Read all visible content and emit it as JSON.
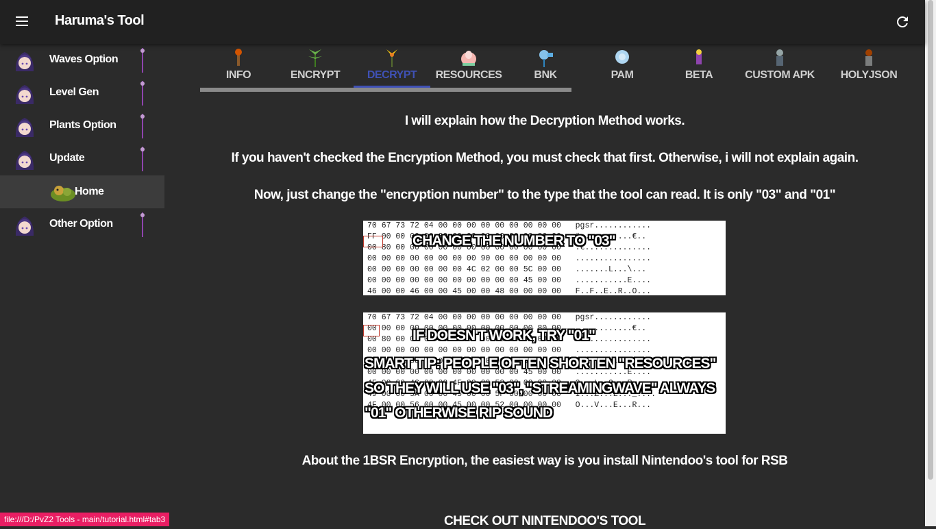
{
  "app": {
    "title": "Haruma's Tool"
  },
  "sidebar": {
    "items": [
      {
        "label": "Waves Option"
      },
      {
        "label": "Level Gen"
      },
      {
        "label": "Plants Option"
      },
      {
        "label": "Update"
      },
      {
        "label": "Home"
      },
      {
        "label": "Other Option"
      }
    ]
  },
  "tabs": [
    {
      "label": "INFO"
    },
    {
      "label": "ENCRYPT"
    },
    {
      "label": "DECRYPT"
    },
    {
      "label": "RESOURCES"
    },
    {
      "label": "BNK"
    },
    {
      "label": "PAM"
    },
    {
      "label": "BETA"
    },
    {
      "label": "CUSTOM APK"
    },
    {
      "label": "HOLYJSON"
    }
  ],
  "active_tab": "DECRYPT",
  "content": {
    "p1": "I will explain how the Decryption Method works.",
    "p2": "If you haven't checked the Encryption Method, you must check that first. Otherwise, i will not explain again.",
    "p3": "Now, just change the \"encryption number\" to the type that the tool can read. It is only \"03\" and \"01\"",
    "p4": "About the 1BSR Encryption, the easiest way is you install Nintendoo's tool for RSB",
    "p5": "CHECK OUT NINTENDOO'S TOOL"
  },
  "image1": {
    "hex": "70 67 73 72 04 00 00 00 00 00 00 00 00 00   pgsr............\nFF 00 00 00 00 00 00 00 00 00 00 00 80 00   ÿ...........€..\n00 80 00 00 00 00 00 00 00 00 00 00 00 00   .€..............\n00 00 00 00 00 00 00 00 90 00 00 00 00 00   ................\n00 00 00 00 00 00 00 4C 02 00 00 5C 00 00   .......L...\\...\n00 00 00 00 00 00 00 00 00 00 00 45 00 00   ...........E....\n46 00 00 46 00 00 45 00 00 48 00 00 00 00   F..F..E..R..O...",
    "overlay": "CHANGE THE NUMBER TO \"03\""
  },
  "image2": {
    "hex": "70 67 73 72 04 00 00 00 00 00 00 00 00 00   pgsr............\n00 00 00 00 00 00 00 00 00 00 00 00 80 00   ............€..\n00 80 00 00 00 00 00 00 00 00 00 00 00 00   .€..............\n00 00 00 00 00 00 00 00 00 00 00 00 00 00   ................\n00 00 00 00 00 00 00 4C 00 00 00 5C 00 00   ........L...\\...\n00 00 00 00 00 00 00 00 00 00 00 45 00 00   ...........E....\n4F 00 00 4C 00 00 4F 00 00 52 00 00 00 00   O...L..O...R....\n49 00 00 5A 00 00 45 00 00 5F 00 00 00 00   I...Z...E..._....\n4F 00 00 56 00 00 45 00 00 52 00 00 00 00   O...V...E...R...",
    "overlay1": "IF DOESN'T WORK, TRY \"01\"",
    "overlay2": "SMART TIP: PEOPLE OFTEN SHORTEN \"RESOURCES\"",
    "overlay3": "SO THEY WILL USE \"03\", \"STREAMINGWAVE\" ALWAYS",
    "overlay4": "\"01\" OTHERWISE RIP SOUND"
  },
  "status_bar": {
    "url": "file:///D:/PvZ2 Tools - main/tutorial.html#tab3"
  },
  "colors": {
    "accent": "#3f51b5",
    "appbar": "#212121",
    "background": "#2b2b2b",
    "status": "#e91e63"
  }
}
